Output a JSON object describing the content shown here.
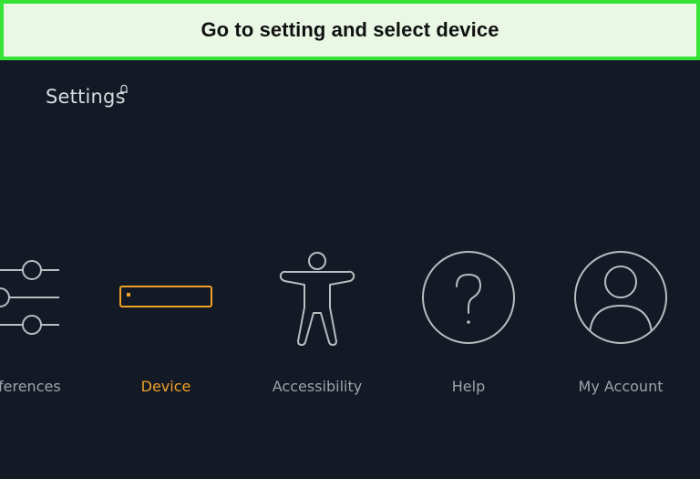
{
  "banner": {
    "text": "Go to setting and select device",
    "border_color": "#34e334",
    "background": "#e9f7e4"
  },
  "screen": {
    "title": "Settings",
    "title_icon": "notification-bell-icon",
    "background": "#131a25",
    "accent": "#f0a027",
    "text_color": "#9ea3aa"
  },
  "menu": {
    "items": [
      {
        "label": "ferences",
        "icon": "sliders-icon",
        "active": false
      },
      {
        "label": "Device",
        "icon": "device-box-icon",
        "active": true
      },
      {
        "label": "Accessibility",
        "icon": "accessibility-person-icon",
        "active": false
      },
      {
        "label": "Help",
        "icon": "question-mark-circle-icon",
        "active": false
      },
      {
        "label": "My Account",
        "icon": "user-avatar-icon",
        "active": false
      }
    ]
  }
}
